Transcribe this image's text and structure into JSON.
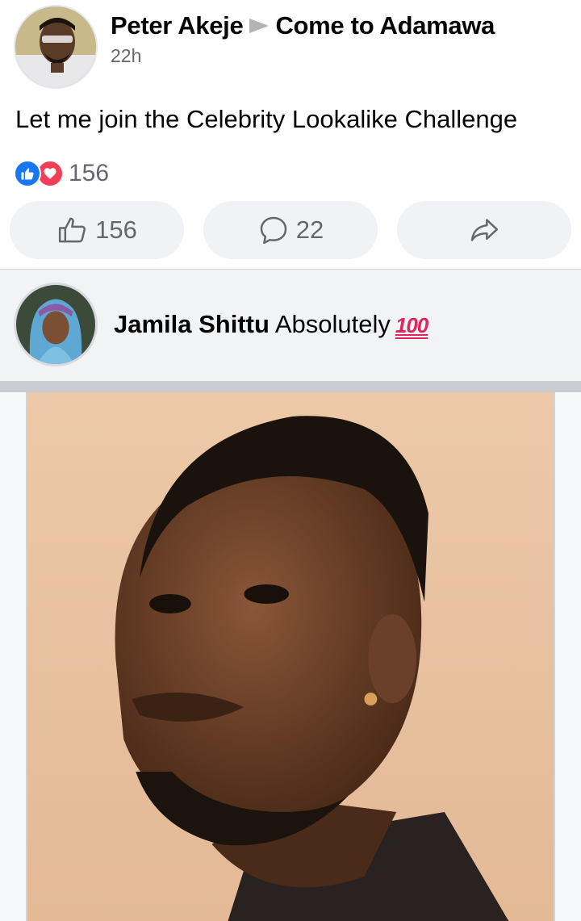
{
  "post": {
    "author": "Peter Akeje",
    "group": "Come to Adamawa",
    "time": "22h",
    "text": "Let me join the Celebrity Lookalike Challenge",
    "reaction_count": "156",
    "reaction_icons": [
      "like-icon",
      "love-icon"
    ]
  },
  "actions": {
    "like_count": "156",
    "comment_count": "22",
    "share_icon": "share-icon"
  },
  "comment": {
    "name": "Jamila Shittu",
    "text": "Absolutely",
    "emoji": "100"
  },
  "colors": {
    "like_blue": "#1877f2",
    "love_red": "#f33e58",
    "button_bg": "#f0f2f5",
    "secondary_text": "#65676b",
    "comment_bg": "#f2f3f5"
  }
}
